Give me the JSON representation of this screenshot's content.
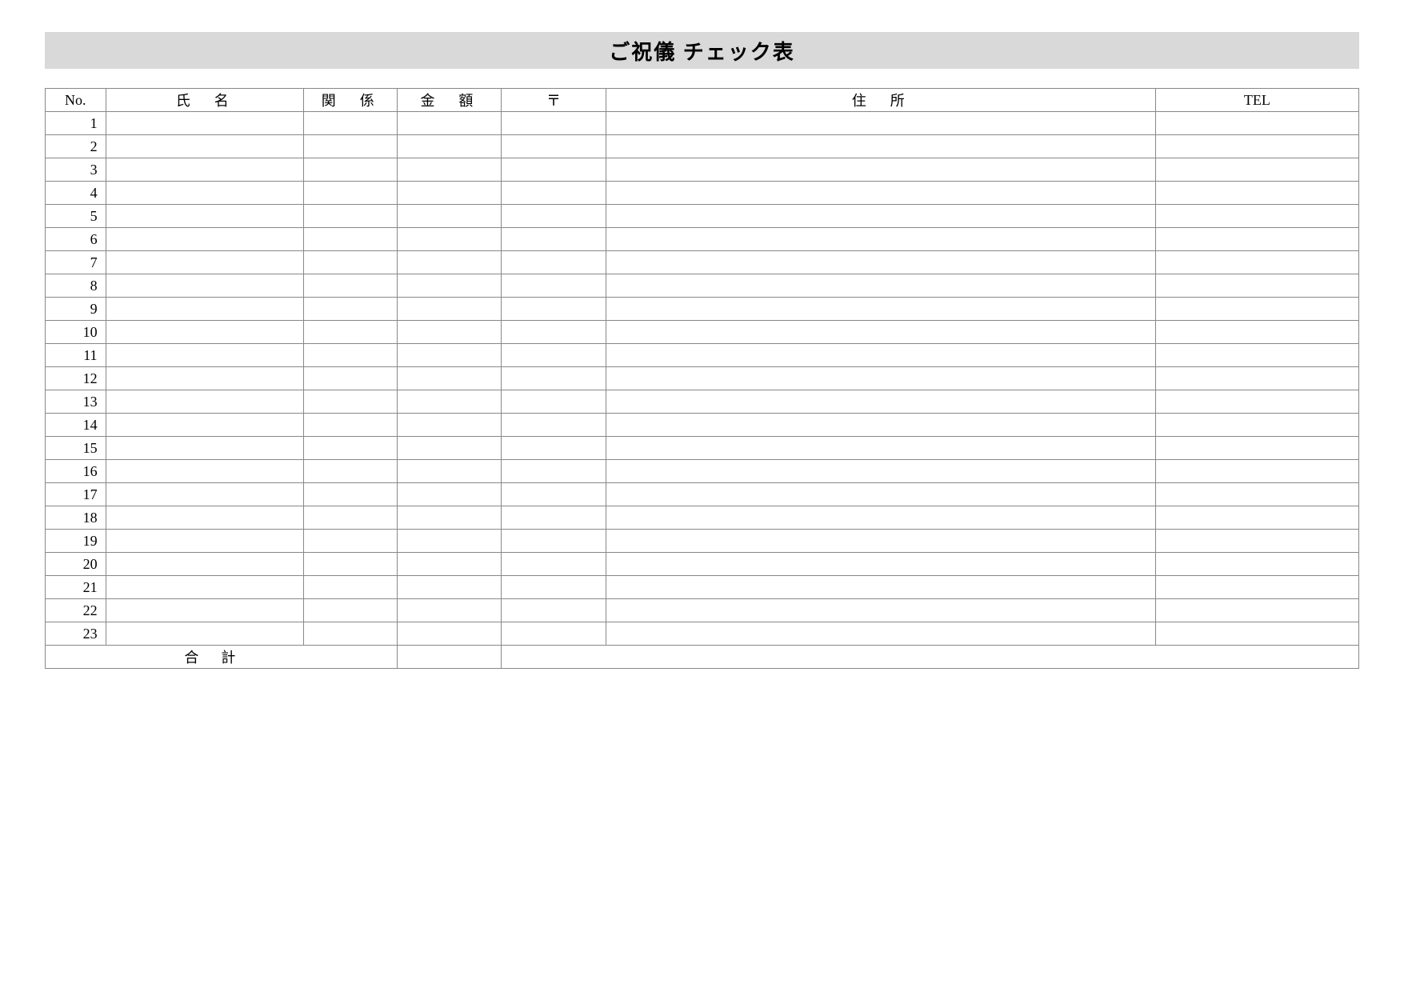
{
  "title": "ご祝儀 チェック表",
  "columns": {
    "no": "No.",
    "name": "氏　名",
    "relation": "関　係",
    "amount": "金　額",
    "postal": "〒",
    "address": "住　所",
    "tel": "TEL"
  },
  "rows": [
    {
      "no": "1"
    },
    {
      "no": "2"
    },
    {
      "no": "3"
    },
    {
      "no": "4"
    },
    {
      "no": "5"
    },
    {
      "no": "6"
    },
    {
      "no": "7"
    },
    {
      "no": "8"
    },
    {
      "no": "9"
    },
    {
      "no": "10"
    },
    {
      "no": "11"
    },
    {
      "no": "12"
    },
    {
      "no": "13"
    },
    {
      "no": "14"
    },
    {
      "no": "15"
    },
    {
      "no": "16"
    },
    {
      "no": "17"
    },
    {
      "no": "18"
    },
    {
      "no": "19"
    },
    {
      "no": "20"
    },
    {
      "no": "21"
    },
    {
      "no": "22"
    },
    {
      "no": "23"
    }
  ],
  "total_label": "合計"
}
